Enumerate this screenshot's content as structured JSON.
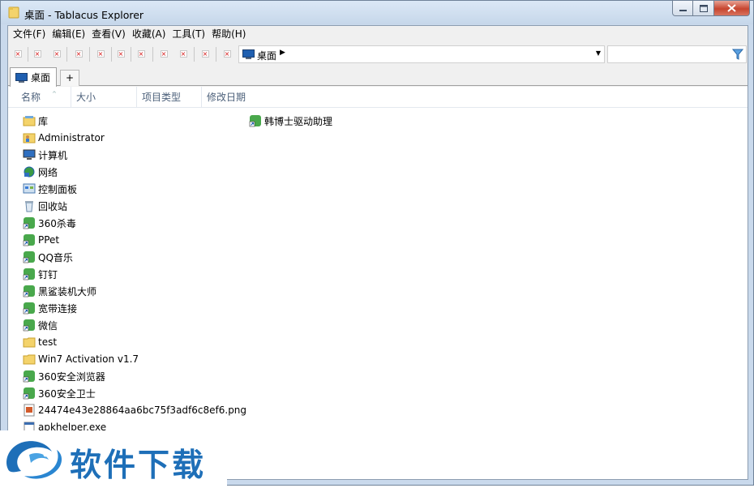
{
  "window": {
    "title": "桌面 - Tablacus Explorer"
  },
  "menubar": [
    "文件(F)",
    "编辑(E)",
    "查看(V)",
    "收藏(A)",
    "工具(T)",
    "帮助(H)"
  ],
  "address": {
    "path": "桌面"
  },
  "search": {
    "value": ""
  },
  "tabs": [
    {
      "label": "桌面"
    }
  ],
  "tab_add_label": "+",
  "columns": [
    "名称",
    "大小",
    "项目类型",
    "修改日期"
  ],
  "items_col1": [
    {
      "name": "库",
      "icon": "library-icon"
    },
    {
      "name": "Administrator",
      "icon": "user-folder-icon"
    },
    {
      "name": "计算机",
      "icon": "computer-icon"
    },
    {
      "name": "网络",
      "icon": "network-icon"
    },
    {
      "name": "控制面板",
      "icon": "control-panel-icon"
    },
    {
      "name": "回收站",
      "icon": "recycle-bin-icon"
    },
    {
      "name": "360杀毒",
      "icon": "shortcut-icon"
    },
    {
      "name": "PPet",
      "icon": "shortcut-icon"
    },
    {
      "name": "QQ音乐",
      "icon": "shortcut-icon"
    },
    {
      "name": "钉钉",
      "icon": "shortcut-icon"
    },
    {
      "name": "黑鲨装机大师",
      "icon": "shortcut-icon"
    },
    {
      "name": "宽带连接",
      "icon": "shortcut-icon"
    },
    {
      "name": "微信",
      "icon": "shortcut-icon"
    },
    {
      "name": "test",
      "icon": "folder-icon"
    },
    {
      "name": "Win7 Activation v1.7",
      "icon": "folder-icon"
    },
    {
      "name": "360安全浏览器",
      "icon": "shortcut-icon"
    },
    {
      "name": "360安全卫士",
      "icon": "shortcut-icon"
    },
    {
      "name": "24474e43e28864aa6bc75f3adf6c8ef6.png",
      "icon": "image-file-icon"
    },
    {
      "name": "apkhelper.exe",
      "icon": "exe-file-icon"
    }
  ],
  "items_col2": [
    {
      "name": "韩博士驱动助理",
      "icon": "shortcut-icon"
    }
  ],
  "watermark": {
    "text": "软件下载"
  }
}
